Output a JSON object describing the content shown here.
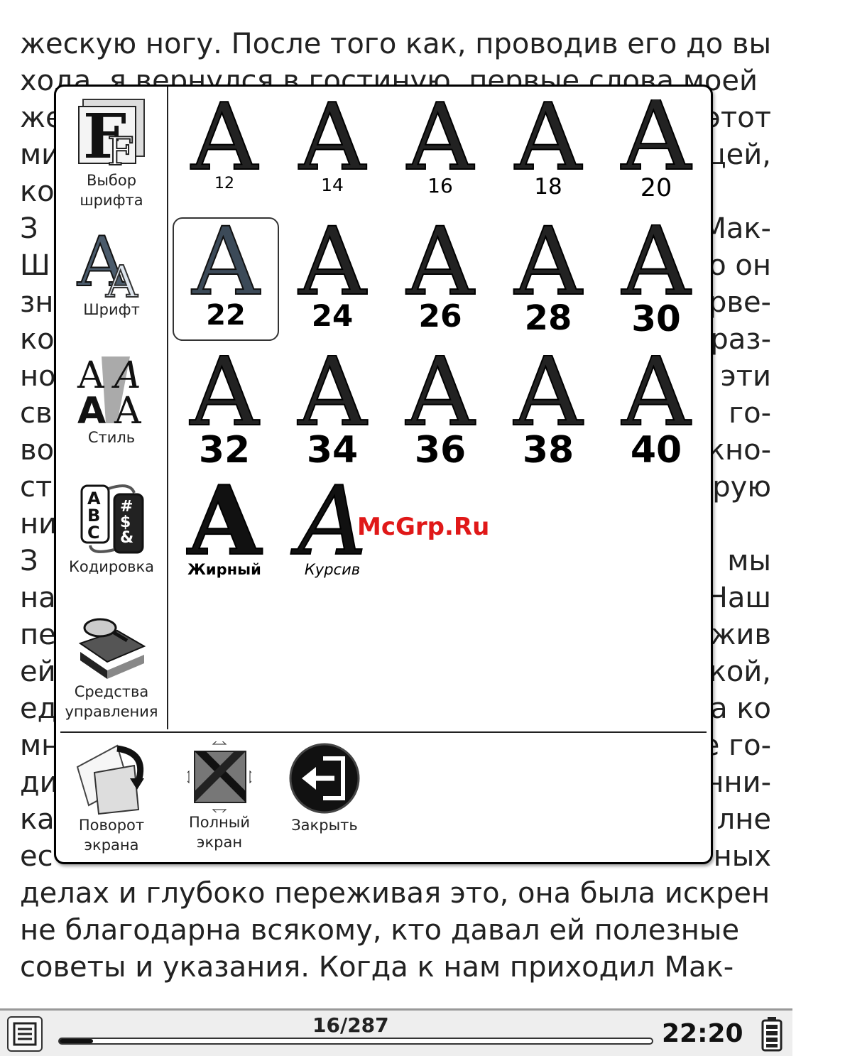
{
  "book_text": [
    [
      "жескую ногу. После того как, проводив его до вы-"
    ],
    [
      "хода, я вернулся в гостиную, первые слова моей"
    ],
    [
      "же",
      "этот"
    ],
    [
      "ми",
      "цей,"
    ],
    [
      "ко",
      ""
    ],
    [
      "З",
      "Мак-"
    ],
    [
      "Ш",
      "о он"
    ],
    [
      "зн",
      "рве-"
    ],
    [
      "ко",
      "раз-"
    ],
    [
      "но",
      "эти"
    ],
    [
      "св",
      "го-"
    ],
    [
      "во",
      "кно-"
    ],
    [
      "ст",
      "рую"
    ],
    [
      "ни",
      ""
    ],
    [
      "З",
      "мы"
    ],
    [
      "на",
      "Наш"
    ],
    [
      "пе",
      "жив"
    ],
    [
      "ей",
      "кой,"
    ],
    [
      "ед",
      "а ко"
    ],
    [
      "мн",
      "е го-"
    ],
    [
      "ди",
      "нни-"
    ],
    [
      "ка",
      "лне"
    ],
    [
      "ес",
      "ных"
    ],
    [
      "делах и глубоко переживая это, она была искрен-"
    ],
    [
      "не благодарна всякому, кто давал ей полезные"
    ],
    [
      "советы и указания. Когда к нам приходил Мак-"
    ]
  ],
  "sidebar": {
    "font_select": "Выбор шрифта",
    "font": "Шрифт",
    "style": "Стиль",
    "encoding": "Кодировка",
    "controls": "Средства управления"
  },
  "font_sizes": [
    "12",
    "14",
    "16",
    "18",
    "20",
    "22",
    "24",
    "26",
    "28",
    "30",
    "32",
    "34",
    "36",
    "38",
    "40"
  ],
  "selected_size": "22",
  "styles": {
    "bold": "Жирный",
    "italic": "Курсив"
  },
  "bottom": {
    "rotate": "Поворот экрана",
    "fullscreen": "Полный экран",
    "close": "Закрыть"
  },
  "watermark": "McGrp.Ru",
  "status": {
    "page": "16/287",
    "time": "22:20",
    "progress": 0.056
  }
}
